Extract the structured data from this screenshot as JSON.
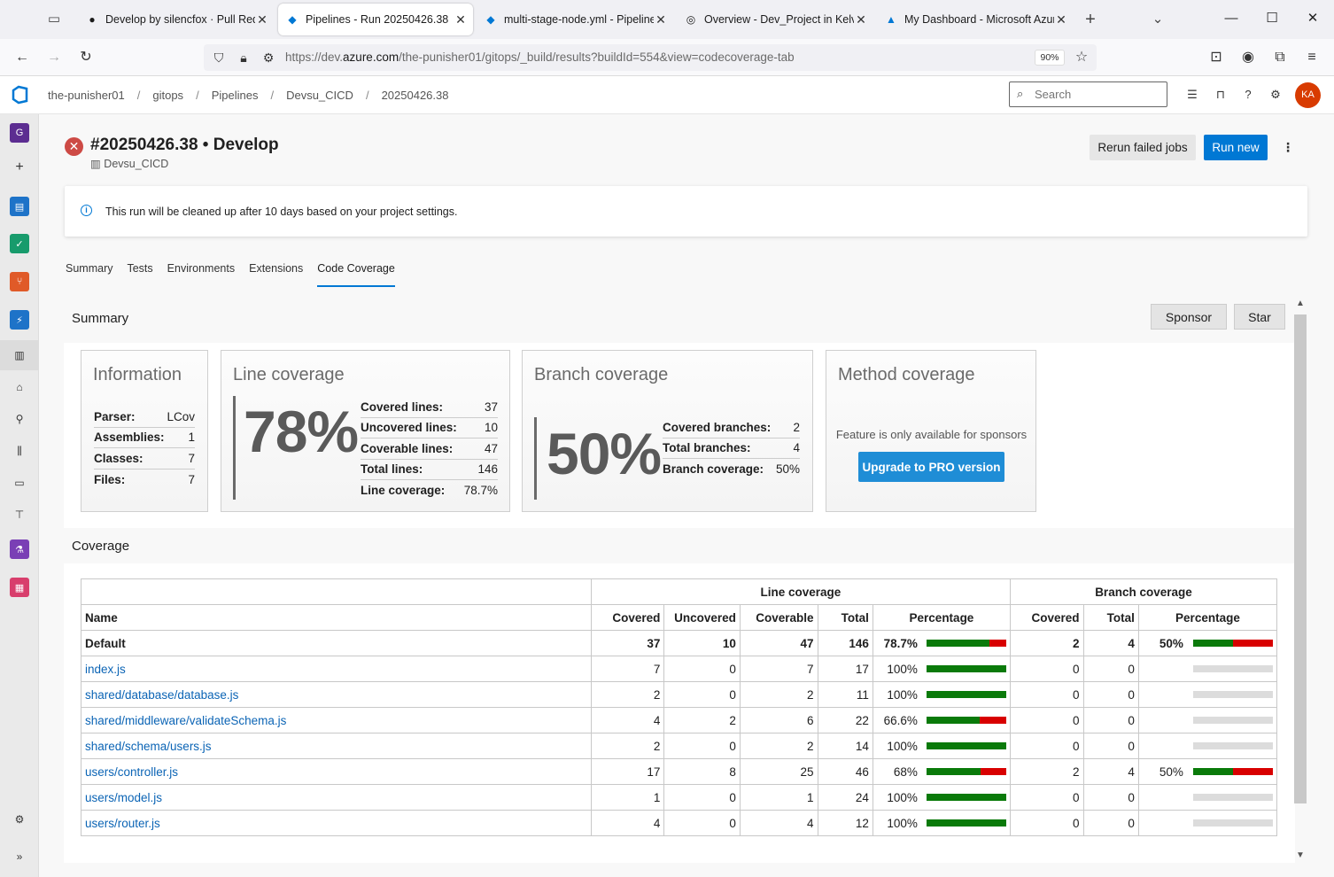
{
  "browser": {
    "tabs": [
      {
        "title": "Develop by silencfox · Pull Requ",
        "icon": "github-icon"
      },
      {
        "title": "Pipelines - Run 20250426.38",
        "icon": "azure-devops-icon",
        "active": true
      },
      {
        "title": "multi-stage-node.yml - Pipeline",
        "icon": "azure-devops-icon"
      },
      {
        "title": "Overview - Dev_Project in Kelvir",
        "icon": "globe-icon"
      },
      {
        "title": "My Dashboard - Microsoft Azur",
        "icon": "azure-icon"
      }
    ],
    "url_prefix": "https://dev.",
    "url_domain": "azure.com",
    "url_rest": "/the-punisher01/gitops/_build/results?buildId=554&view=codecoverage-tab",
    "zoom": "90%"
  },
  "header": {
    "breadcrumbs": [
      "the-punisher01",
      "gitops",
      "Pipelines",
      "Devsu_CICD",
      "20250426.38"
    ],
    "search_placeholder": "Search",
    "avatar_initials": "KA"
  },
  "rail": {
    "org_initial": "G"
  },
  "run": {
    "title": "#20250426.38 • Develop",
    "pipeline": "Devsu_CICD",
    "rerun_label": "Rerun failed jobs",
    "run_new_label": "Run new"
  },
  "notice": "This run will be cleaned up after 10 days based on your project settings.",
  "page_tabs": [
    "Summary",
    "Tests",
    "Environments",
    "Extensions",
    "Code Coverage"
  ],
  "report": {
    "summary_heading": "Summary",
    "sponsor_label": "Sponsor",
    "star_label": "Star",
    "information": {
      "title": "Information",
      "rows": [
        {
          "k": "Parser:",
          "v": "LCov"
        },
        {
          "k": "Assemblies:",
          "v": "1"
        },
        {
          "k": "Classes:",
          "v": "7"
        },
        {
          "k": "Files:",
          "v": "7"
        }
      ]
    },
    "line_coverage": {
      "title": "Line coverage",
      "big": "78%",
      "rows": [
        {
          "k": "Covered lines:",
          "v": "37"
        },
        {
          "k": "Uncovered lines:",
          "v": "10"
        },
        {
          "k": "Coverable lines:",
          "v": "47"
        },
        {
          "k": "Total lines:",
          "v": "146"
        },
        {
          "k": "Line coverage:",
          "v": "78.7%"
        }
      ]
    },
    "branch_coverage": {
      "title": "Branch coverage",
      "big": "50%",
      "rows": [
        {
          "k": "Covered branches:",
          "v": "2"
        },
        {
          "k": "Total branches:",
          "v": "4"
        },
        {
          "k": "Branch coverage:",
          "v": "50%"
        }
      ]
    },
    "method_coverage": {
      "title": "Method coverage",
      "feature_text": "Feature is only available for sponsors",
      "upgrade_label": "Upgrade to PRO version"
    },
    "coverage_heading": "Coverage",
    "table": {
      "group_line": "Line coverage",
      "group_branch": "Branch coverage",
      "columns": [
        "Name",
        "Covered",
        "Uncovered",
        "Coverable",
        "Total",
        "Percentage",
        "Covered",
        "Total",
        "Percentage"
      ],
      "rows": [
        {
          "name": "Default",
          "covered": "37",
          "uncovered": "10",
          "coverable": "47",
          "total": "146",
          "pct": "78.7%",
          "line_fraction": 0.787,
          "b_covered": "2",
          "b_total": "4",
          "b_pct": "50%",
          "branch_fraction": 0.5,
          "total_row": true
        },
        {
          "name": "index.js",
          "covered": "7",
          "uncovered": "0",
          "coverable": "7",
          "total": "17",
          "pct": "100%",
          "line_fraction": 1.0,
          "b_covered": "0",
          "b_total": "0",
          "b_pct": "",
          "branch_fraction": null
        },
        {
          "name": "shared/database/database.js",
          "covered": "2",
          "uncovered": "0",
          "coverable": "2",
          "total": "11",
          "pct": "100%",
          "line_fraction": 1.0,
          "b_covered": "0",
          "b_total": "0",
          "b_pct": "",
          "branch_fraction": null
        },
        {
          "name": "shared/middleware/validateSchema.js",
          "covered": "4",
          "uncovered": "2",
          "coverable": "6",
          "total": "22",
          "pct": "66.6%",
          "line_fraction": 0.666,
          "b_covered": "0",
          "b_total": "0",
          "b_pct": "",
          "branch_fraction": null
        },
        {
          "name": "shared/schema/users.js",
          "covered": "2",
          "uncovered": "0",
          "coverable": "2",
          "total": "14",
          "pct": "100%",
          "line_fraction": 1.0,
          "b_covered": "0",
          "b_total": "0",
          "b_pct": "",
          "branch_fraction": null
        },
        {
          "name": "users/controller.js",
          "covered": "17",
          "uncovered": "8",
          "coverable": "25",
          "total": "46",
          "pct": "68%",
          "line_fraction": 0.68,
          "b_covered": "2",
          "b_total": "4",
          "b_pct": "50%",
          "branch_fraction": 0.5
        },
        {
          "name": "users/model.js",
          "covered": "1",
          "uncovered": "0",
          "coverable": "1",
          "total": "24",
          "pct": "100%",
          "line_fraction": 1.0,
          "b_covered": "0",
          "b_total": "0",
          "b_pct": "",
          "branch_fraction": null
        },
        {
          "name": "users/router.js",
          "covered": "4",
          "uncovered": "0",
          "coverable": "4",
          "total": "12",
          "pct": "100%",
          "line_fraction": 1.0,
          "b_covered": "0",
          "b_total": "0",
          "b_pct": "",
          "branch_fraction": null
        }
      ]
    }
  },
  "colors": {
    "accent": "#0078d4",
    "covered": "#0a7a0a",
    "uncovered": "#d80000",
    "failed": "#cd4a45"
  }
}
